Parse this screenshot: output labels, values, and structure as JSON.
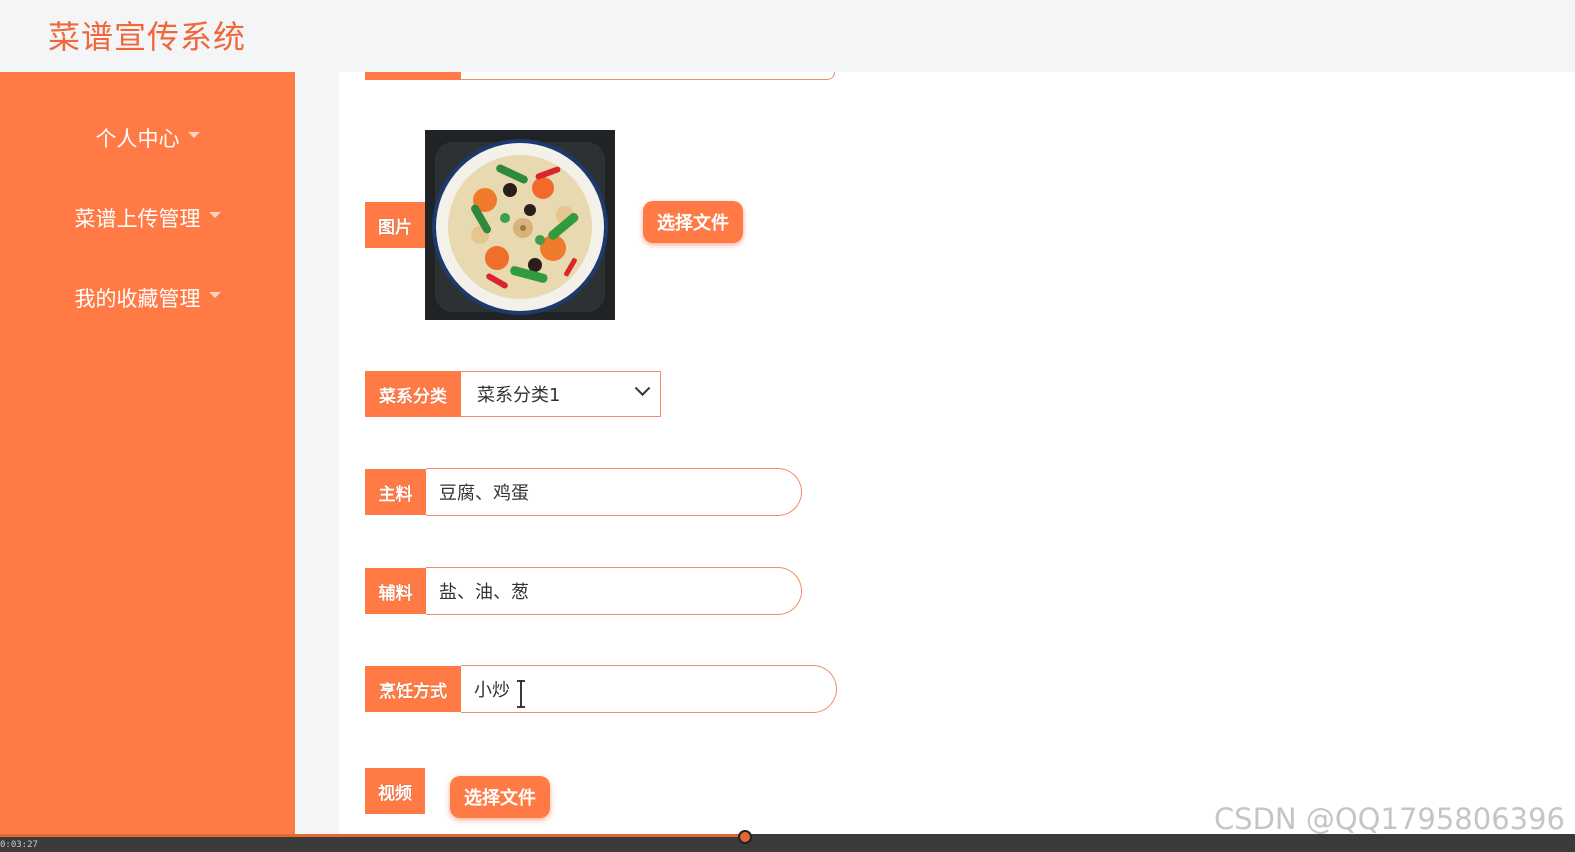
{
  "app": {
    "title": "菜谱宣传系统"
  },
  "sidebar": {
    "items": [
      {
        "label": "个人中心"
      },
      {
        "label": "菜谱上传管理"
      },
      {
        "label": "我的收藏管理"
      }
    ]
  },
  "form": {
    "image": {
      "label": "图片",
      "button": "选择文件"
    },
    "category": {
      "label": "菜系分类",
      "selected": "菜系分类1"
    },
    "main_ingredient": {
      "label": "主料",
      "value": "豆腐、鸡蛋"
    },
    "side_ingredient": {
      "label": "辅料",
      "value": "盐、油、葱"
    },
    "cooking_method": {
      "label": "烹饪方式",
      "value": "小炒"
    },
    "video": {
      "label": "视频",
      "button": "选择文件"
    }
  },
  "player": {
    "timecode": "0:03:27",
    "progress": 0.47
  },
  "watermark": "CSDN @QQ1795806396",
  "colors": {
    "accent": "#ff7a45",
    "title": "#f0683a",
    "field_border": "#f08d6a"
  }
}
